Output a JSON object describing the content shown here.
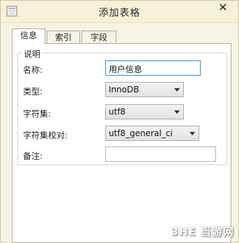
{
  "window": {
    "title": "添加表格",
    "close_label": "✕"
  },
  "tabs": [
    {
      "label": "信息",
      "active": true
    },
    {
      "label": "索引",
      "active": false
    },
    {
      "label": "字段",
      "active": false
    }
  ],
  "group": {
    "legend": "说明"
  },
  "fields": {
    "name": {
      "label": "名称:",
      "value": "用户信息"
    },
    "type": {
      "label": "类型:",
      "value": "InnoDB"
    },
    "charset": {
      "label": "字符集:",
      "value": "utf8"
    },
    "collation": {
      "label": "字符集校对:",
      "value": "utf8_general_ci"
    },
    "comment": {
      "label": "备注:",
      "value": ""
    }
  },
  "watermark": {
    "text": "3HE 当游网"
  },
  "colors": {
    "window_bg": "#f6f3e6",
    "panel_bg": "#ffffff",
    "focus_border": "#3a8bc9"
  },
  "icons": {
    "app": "app-icon",
    "close": "close-icon",
    "dropdown": "chevron-down-icon"
  }
}
